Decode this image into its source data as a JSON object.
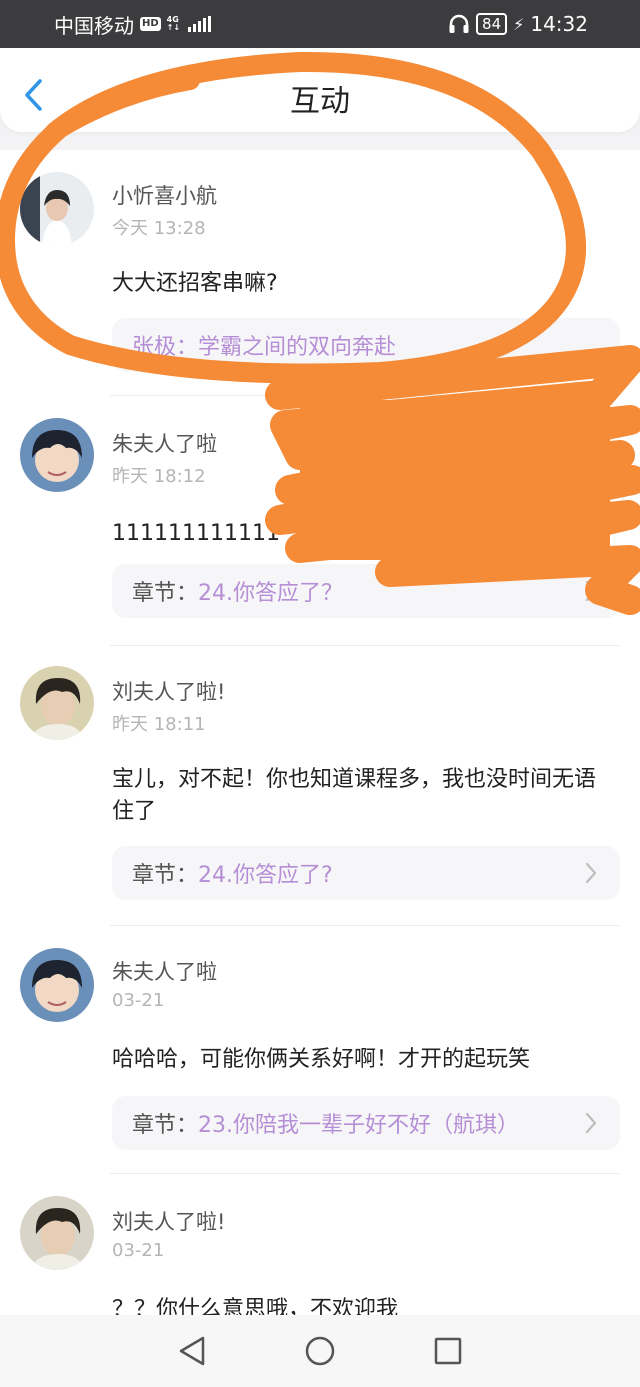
{
  "status_bar": {
    "carrier": "中国移动",
    "hd": "HD",
    "network_top": "4G",
    "network_bottom": "↑↓",
    "battery": "84",
    "time": "14:32",
    "icons": [
      "headphones-icon",
      "battery-icon",
      "charging-bolt-icon",
      "signal-icon"
    ]
  },
  "header": {
    "title": "互动",
    "back_icon": "chevron-left-icon"
  },
  "comments": [
    {
      "username": "小忻喜小航",
      "time": "今天 13:28",
      "content": "大大还招客串嘛?",
      "chapter_label": "张极：",
      "chapter_title": "学霸之间的双向奔赴"
    },
    {
      "username": "朱夫人了啦",
      "time": "昨天 18:12",
      "content": "111111111111",
      "chapter_label": "章节：",
      "chapter_title": "24.你答应了？"
    },
    {
      "username": "刘夫人了啦!",
      "time": "昨天 18:11",
      "content": "宝儿，对不起！你也知道课程多，我也没时间无语住了",
      "chapter_label": "章节：",
      "chapter_title": "24.你答应了?"
    },
    {
      "username": "朱夫人了啦",
      "time": "03-21",
      "content": "哈哈哈，可能你俩关系好啊！才开的起玩笑",
      "chapter_label": "章节：",
      "chapter_title": "23.你陪我一辈子好不好（航琪）"
    },
    {
      "username": "刘夫人了啦!",
      "time": "03-21",
      "content": "？？你什么意思哦，不欢迎我",
      "chapter_label": "",
      "chapter_title": ""
    }
  ],
  "annotation": {
    "color": "#f58a37"
  },
  "system_nav": {
    "icons": [
      "back-triangle-icon",
      "home-circle-icon",
      "recents-square-icon"
    ]
  }
}
